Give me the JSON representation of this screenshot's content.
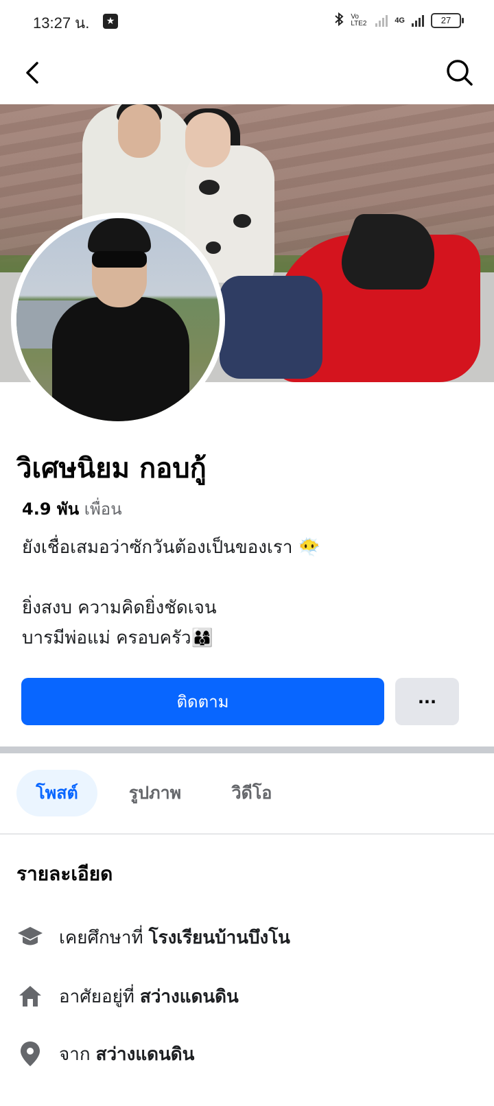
{
  "status_bar": {
    "time": "13:27 น.",
    "battery": "27",
    "network": "4G",
    "volte": "Vo LTE2"
  },
  "nav": {
    "back_icon": "back-arrow-icon",
    "search_icon": "search-icon"
  },
  "profile": {
    "name": "วิเศษนิยม กอบกู้",
    "friends_count": "4.9 พัน",
    "friends_label": "เพื่อน",
    "bio": "ยังเชื่อเสมอว่าซักวันต้องเป็นของเรา 😶‍🌫️\n\nยิ่งสงบ ความคิดยิ่งชัดเจน\nบารมีพ่อแม่ ครอบครัว👨‍👩‍👦"
  },
  "actions": {
    "follow_label": "ติดตาม",
    "more_label": "···"
  },
  "tabs": [
    {
      "label": "โพสต์",
      "active": true
    },
    {
      "label": "รูปภาพ",
      "active": false
    },
    {
      "label": "วิดีโอ",
      "active": false
    }
  ],
  "details": {
    "title": "รายละเอียด",
    "items": [
      {
        "icon": "graduation-cap-icon",
        "prefix": "เคยศึกษาที่",
        "value": "โรงเรียนบ้านบึงโน"
      },
      {
        "icon": "home-icon",
        "prefix": "อาศัยอยู่ที่",
        "value": "สว่างแดนดิน"
      },
      {
        "icon": "location-pin-icon",
        "prefix": "จาก",
        "value": "สว่างแดนดิน"
      }
    ]
  },
  "colors": {
    "primary": "#0866ff",
    "secondary_button": "#e4e6eb",
    "active_tab_bg": "#ebf5ff",
    "muted_text": "#65676b"
  }
}
